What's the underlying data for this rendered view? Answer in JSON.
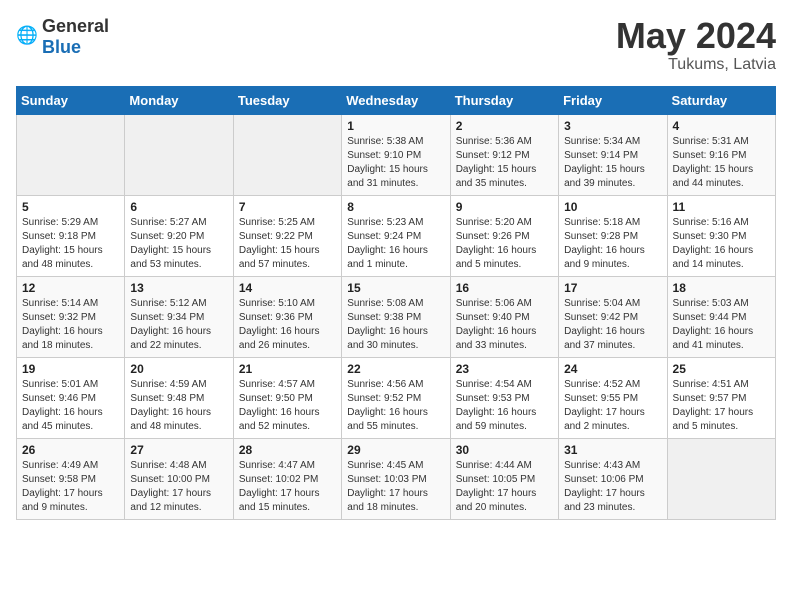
{
  "header": {
    "logo_general": "General",
    "logo_blue": "Blue",
    "month_year": "May 2024",
    "location": "Tukums, Latvia"
  },
  "days_of_week": [
    "Sunday",
    "Monday",
    "Tuesday",
    "Wednesday",
    "Thursday",
    "Friday",
    "Saturday"
  ],
  "weeks": [
    [
      {
        "day": "",
        "empty": true
      },
      {
        "day": "",
        "empty": true
      },
      {
        "day": "",
        "empty": true
      },
      {
        "day": "1",
        "sunrise": "5:38 AM",
        "sunset": "9:10 PM",
        "daylight": "15 hours and 31 minutes."
      },
      {
        "day": "2",
        "sunrise": "5:36 AM",
        "sunset": "9:12 PM",
        "daylight": "15 hours and 35 minutes."
      },
      {
        "day": "3",
        "sunrise": "5:34 AM",
        "sunset": "9:14 PM",
        "daylight": "15 hours and 39 minutes."
      },
      {
        "day": "4",
        "sunrise": "5:31 AM",
        "sunset": "9:16 PM",
        "daylight": "15 hours and 44 minutes."
      }
    ],
    [
      {
        "day": "5",
        "sunrise": "5:29 AM",
        "sunset": "9:18 PM",
        "daylight": "15 hours and 48 minutes."
      },
      {
        "day": "6",
        "sunrise": "5:27 AM",
        "sunset": "9:20 PM",
        "daylight": "15 hours and 53 minutes."
      },
      {
        "day": "7",
        "sunrise": "5:25 AM",
        "sunset": "9:22 PM",
        "daylight": "15 hours and 57 minutes."
      },
      {
        "day": "8",
        "sunrise": "5:23 AM",
        "sunset": "9:24 PM",
        "daylight": "16 hours and 1 minute."
      },
      {
        "day": "9",
        "sunrise": "5:20 AM",
        "sunset": "9:26 PM",
        "daylight": "16 hours and 5 minutes."
      },
      {
        "day": "10",
        "sunrise": "5:18 AM",
        "sunset": "9:28 PM",
        "daylight": "16 hours and 9 minutes."
      },
      {
        "day": "11",
        "sunrise": "5:16 AM",
        "sunset": "9:30 PM",
        "daylight": "16 hours and 14 minutes."
      }
    ],
    [
      {
        "day": "12",
        "sunrise": "5:14 AM",
        "sunset": "9:32 PM",
        "daylight": "16 hours and 18 minutes."
      },
      {
        "day": "13",
        "sunrise": "5:12 AM",
        "sunset": "9:34 PM",
        "daylight": "16 hours and 22 minutes."
      },
      {
        "day": "14",
        "sunrise": "5:10 AM",
        "sunset": "9:36 PM",
        "daylight": "16 hours and 26 minutes."
      },
      {
        "day": "15",
        "sunrise": "5:08 AM",
        "sunset": "9:38 PM",
        "daylight": "16 hours and 30 minutes."
      },
      {
        "day": "16",
        "sunrise": "5:06 AM",
        "sunset": "9:40 PM",
        "daylight": "16 hours and 33 minutes."
      },
      {
        "day": "17",
        "sunrise": "5:04 AM",
        "sunset": "9:42 PM",
        "daylight": "16 hours and 37 minutes."
      },
      {
        "day": "18",
        "sunrise": "5:03 AM",
        "sunset": "9:44 PM",
        "daylight": "16 hours and 41 minutes."
      }
    ],
    [
      {
        "day": "19",
        "sunrise": "5:01 AM",
        "sunset": "9:46 PM",
        "daylight": "16 hours and 45 minutes."
      },
      {
        "day": "20",
        "sunrise": "4:59 AM",
        "sunset": "9:48 PM",
        "daylight": "16 hours and 48 minutes."
      },
      {
        "day": "21",
        "sunrise": "4:57 AM",
        "sunset": "9:50 PM",
        "daylight": "16 hours and 52 minutes."
      },
      {
        "day": "22",
        "sunrise": "4:56 AM",
        "sunset": "9:52 PM",
        "daylight": "16 hours and 55 minutes."
      },
      {
        "day": "23",
        "sunrise": "4:54 AM",
        "sunset": "9:53 PM",
        "daylight": "16 hours and 59 minutes."
      },
      {
        "day": "24",
        "sunrise": "4:52 AM",
        "sunset": "9:55 PM",
        "daylight": "17 hours and 2 minutes."
      },
      {
        "day": "25",
        "sunrise": "4:51 AM",
        "sunset": "9:57 PM",
        "daylight": "17 hours and 5 minutes."
      }
    ],
    [
      {
        "day": "26",
        "sunrise": "4:49 AM",
        "sunset": "9:58 PM",
        "daylight": "17 hours and 9 minutes."
      },
      {
        "day": "27",
        "sunrise": "4:48 AM",
        "sunset": "10:00 PM",
        "daylight": "17 hours and 12 minutes."
      },
      {
        "day": "28",
        "sunrise": "4:47 AM",
        "sunset": "10:02 PM",
        "daylight": "17 hours and 15 minutes."
      },
      {
        "day": "29",
        "sunrise": "4:45 AM",
        "sunset": "10:03 PM",
        "daylight": "17 hours and 18 minutes."
      },
      {
        "day": "30",
        "sunrise": "4:44 AM",
        "sunset": "10:05 PM",
        "daylight": "17 hours and 20 minutes."
      },
      {
        "day": "31",
        "sunrise": "4:43 AM",
        "sunset": "10:06 PM",
        "daylight": "17 hours and 23 minutes."
      },
      {
        "day": "",
        "empty": true
      }
    ]
  ],
  "labels": {
    "sunrise": "Sunrise:",
    "sunset": "Sunset:",
    "daylight": "Daylight:"
  }
}
